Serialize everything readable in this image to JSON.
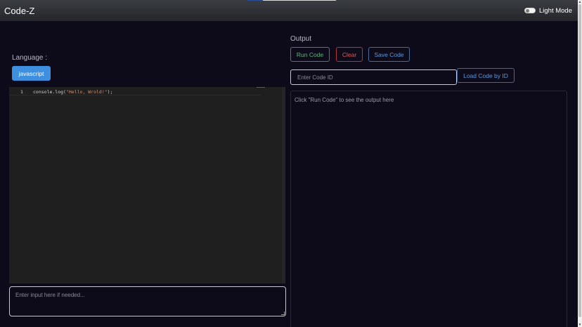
{
  "navbar": {
    "brand": "Code-Z",
    "theme_label": "Light Mode"
  },
  "editor": {
    "language_label": "Language :",
    "language": "javascript",
    "line_number": "1",
    "code_fn": "console.log(",
    "code_str": "\"Hello, Wrold!\"",
    "code_end": ");"
  },
  "stdin": {
    "placeholder": "Enter input here if needed..."
  },
  "output": {
    "title": "Output",
    "run_label": "Run Code",
    "clear_label": "Clear",
    "save_label": "Save Code",
    "code_id_placeholder": "Enter Code ID",
    "load_label": "Load Code by ID",
    "placeholder_text": "Click \"Run Code\" to see the output here"
  },
  "colors": {
    "background": "#0d0b1a",
    "navbar": "#2e3034",
    "language_button": "#3f8fe0",
    "run": "#5fb87a",
    "clear": "#e05858",
    "save": "#5a9ae0"
  },
  "icons": [
    "toggle-switch-icon",
    "resize-grip-icon",
    "scroll-up-arrow-icon",
    "scroll-down-arrow-icon"
  ]
}
